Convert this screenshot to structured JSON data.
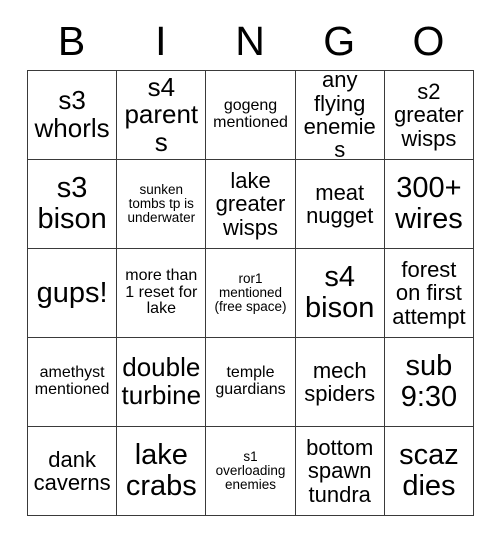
{
  "card": {
    "header": {
      "letters": [
        "B",
        "I",
        "N",
        "G",
        "O"
      ]
    },
    "columns": 5,
    "rows": 5,
    "colors": {
      "background": "#ffffff",
      "text": "#000000",
      "grid_line": "#3a3a3a"
    },
    "cells": [
      [
        {
          "text": "s3 whorls",
          "size": "lg"
        },
        {
          "text": "s4 parents",
          "size": "lg"
        },
        {
          "text": "gogeng mentioned",
          "size": "sm"
        },
        {
          "text": "any flying enemies",
          "size": "md"
        },
        {
          "text": "s2 greater wisps",
          "size": "md"
        }
      ],
      [
        {
          "text": "s3 bison",
          "size": "xl"
        },
        {
          "text": "sunken tombs tp is underwater",
          "size": "xs"
        },
        {
          "text": "lake greater wisps",
          "size": "md"
        },
        {
          "text": "meat nugget",
          "size": "md"
        },
        {
          "text": "300+ wires",
          "size": "xl"
        }
      ],
      [
        {
          "text": "gups!",
          "size": "xl"
        },
        {
          "text": "more than 1 reset for lake",
          "size": "sm"
        },
        {
          "text": "ror1 mentioned (free space)",
          "size": "xs"
        },
        {
          "text": "s4 bison",
          "size": "xl"
        },
        {
          "text": "forest on first attempt",
          "size": "md"
        }
      ],
      [
        {
          "text": "amethyst mentioned",
          "size": "sm"
        },
        {
          "text": "double turbine",
          "size": "lg"
        },
        {
          "text": "temple guardians",
          "size": "sm"
        },
        {
          "text": "mech spiders",
          "size": "md"
        },
        {
          "text": "sub 9:30",
          "size": "xl"
        }
      ],
      [
        {
          "text": "dank caverns",
          "size": "md"
        },
        {
          "text": "lake crabs",
          "size": "xl"
        },
        {
          "text": "s1 overloading enemies",
          "size": "xs"
        },
        {
          "text": "bottom spawn tundra",
          "size": "md"
        },
        {
          "text": "scaz dies",
          "size": "xl"
        }
      ]
    ]
  }
}
